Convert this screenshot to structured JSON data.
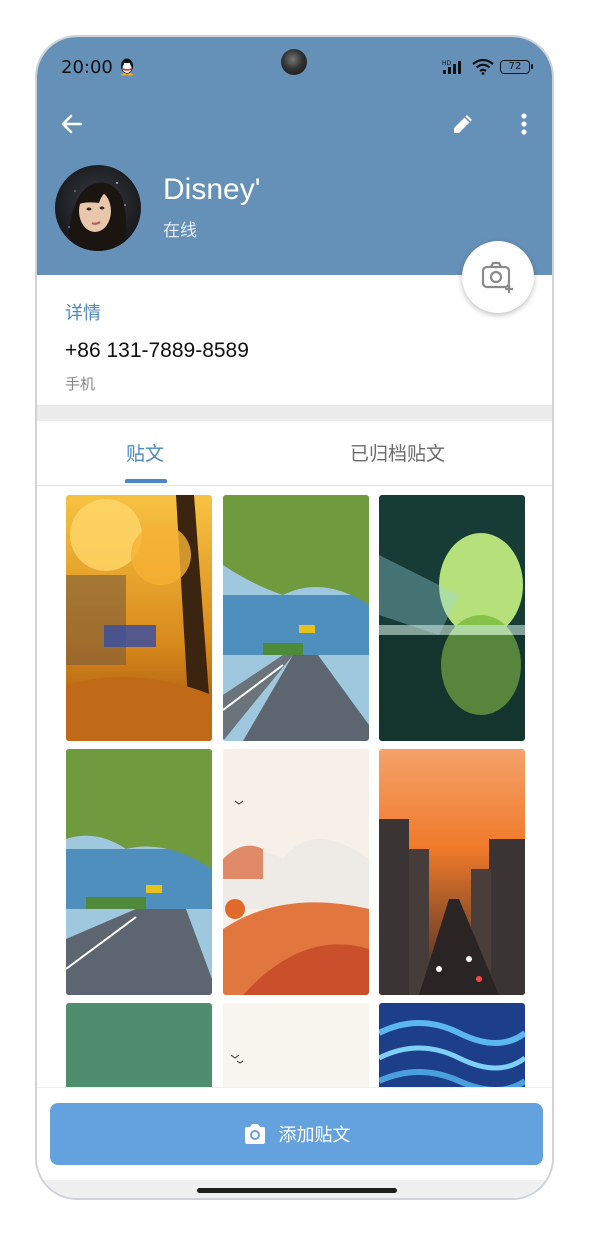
{
  "status_bar": {
    "time": "20:00",
    "battery": "72",
    "network_label": "HD",
    "icons": [
      "qq-icon",
      "signal-icon",
      "wifi-icon",
      "battery-icon"
    ]
  },
  "header": {
    "name": "Disney'",
    "status": "在线",
    "color": "#6590b8"
  },
  "details": {
    "section_title": "详情",
    "phone_number": "+86 131-7889-8589",
    "phone_label": "手机"
  },
  "tabs": [
    {
      "label": "贴文",
      "active": true
    },
    {
      "label": "已归档贴文",
      "active": false
    }
  ],
  "grid": {
    "photos": [
      {
        "desc": "autumn-tree"
      },
      {
        "desc": "seaside-road"
      },
      {
        "desc": "cave-reflection"
      },
      {
        "desc": "seaside-road"
      },
      {
        "desc": "desert-dunes"
      },
      {
        "desc": "city-sunset"
      },
      {
        "desc": "green-tile"
      },
      {
        "desc": "pale-dunes"
      },
      {
        "desc": "blue-waves"
      }
    ]
  },
  "action": {
    "add_post_label": "添加贴文"
  },
  "accent_color": "#4a88c8",
  "button_color": "#64a1df"
}
